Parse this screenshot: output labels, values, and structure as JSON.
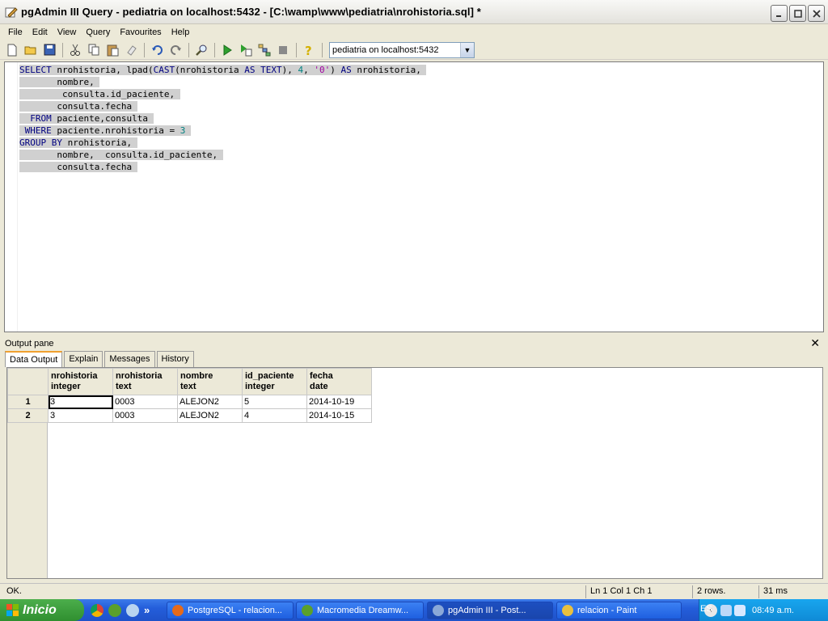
{
  "window": {
    "title": "pgAdmin III Query - pediatria on localhost:5432 - [C:\\wamp\\www\\pediatria\\nrohistoria.sql] *"
  },
  "menu": [
    "File",
    "Edit",
    "View",
    "Query",
    "Favourites",
    "Help"
  ],
  "toolbar": {
    "icons": [
      "new-file-icon",
      "open-folder-icon",
      "save-icon",
      "cut-icon",
      "copy-icon",
      "paste-icon",
      "clear-icon",
      "undo-icon",
      "redo-icon",
      "find-icon",
      "execute-icon",
      "execute-to-file-icon",
      "explain-icon",
      "stop-icon",
      "help-icon"
    ],
    "connection": "pediatria on localhost:5432"
  },
  "editor": {
    "lines": [
      "SELECT nrohistoria, lpad(CAST(nrohistoria AS TEXT), 4, '0') AS nrohistoria,",
      "       nombre,",
      "        consulta.id_paciente,",
      "       consulta.fecha",
      "  FROM paciente,consulta",
      " WHERE paciente.nrohistoria = 3",
      "GROUP BY nrohistoria,",
      "       nombre,  consulta.id_paciente,",
      "       consulta.fecha"
    ]
  },
  "output": {
    "title": "Output pane",
    "tabs": [
      "Data Output",
      "Explain",
      "Messages",
      "History"
    ],
    "columns": [
      {
        "name": "nrohistoria",
        "type": "integer"
      },
      {
        "name": "nrohistoria",
        "type": "text"
      },
      {
        "name": "nombre",
        "type": "text"
      },
      {
        "name": "id_paciente",
        "type": "integer"
      },
      {
        "name": "fecha",
        "type": "date"
      }
    ],
    "rows": [
      {
        "num": "1",
        "cells": [
          "3",
          "0003",
          "ALEJON2",
          "5",
          "2014-10-19"
        ]
      },
      {
        "num": "2",
        "cells": [
          "3",
          "0003",
          "ALEJON2",
          "4",
          "2014-10-15"
        ]
      }
    ]
  },
  "status": {
    "message": "OK.",
    "position": "Ln 1 Col 1 Ch 1",
    "rows": "2 rows.",
    "time": "31 ms"
  },
  "taskbar": {
    "start_label": "Inicio",
    "tasks": [
      "PostgreSQL - relacion...",
      "Macromedia Dreamw...",
      "pgAdmin III - Post...",
      "relacion - Paint"
    ],
    "language": "ES",
    "clock": "08:49 a.m."
  }
}
